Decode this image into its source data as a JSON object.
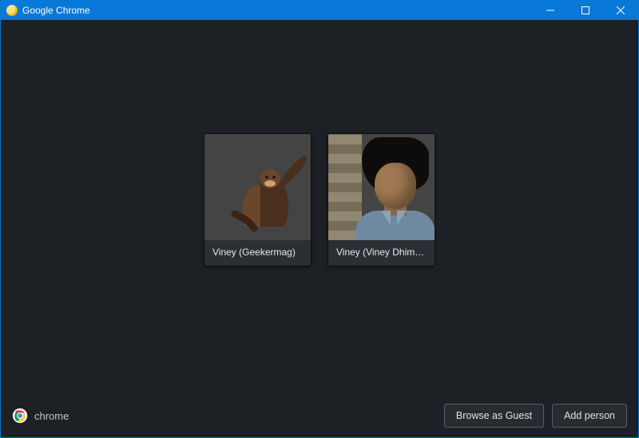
{
  "window": {
    "title": "Google Chrome"
  },
  "profiles": [
    {
      "label": "Viney (Geekermag)"
    },
    {
      "label": "Viney (Viney Dhim…"
    }
  ],
  "footer": {
    "brand": "chrome",
    "guest_label": "Browse as Guest",
    "add_label": "Add person"
  }
}
